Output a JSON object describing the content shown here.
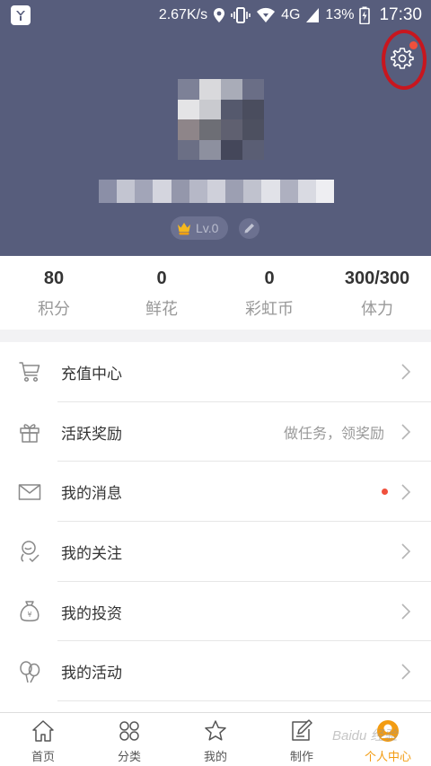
{
  "status_bar": {
    "net_speed": "2.67K/s",
    "network": "4G",
    "battery": "13%",
    "time": "17:30"
  },
  "profile": {
    "level": "Lv.0"
  },
  "stats": [
    {
      "value": "80",
      "label": "积分"
    },
    {
      "value": "0",
      "label": "鲜花"
    },
    {
      "value": "0",
      "label": "彩虹币"
    },
    {
      "value": "300/300",
      "label": "体力"
    }
  ],
  "menu": [
    {
      "label": "充值中心",
      "icon": "cart-icon"
    },
    {
      "label": "活跃奖励",
      "icon": "gift-icon",
      "hint": "做任务，领奖励"
    },
    {
      "label": "我的消息",
      "icon": "envelope-icon",
      "has_dot": true
    },
    {
      "label": "我的关注",
      "icon": "follow-icon"
    },
    {
      "label": "我的投资",
      "icon": "money-bag-icon"
    },
    {
      "label": "我的活动",
      "icon": "balloon-icon"
    }
  ],
  "tabs": [
    {
      "label": "首页",
      "icon": "home-icon"
    },
    {
      "label": "分类",
      "icon": "category-icon"
    },
    {
      "label": "我的",
      "icon": "star-icon"
    },
    {
      "label": "制作",
      "icon": "edit-icon"
    },
    {
      "label": "个人中心",
      "icon": "profile-icon",
      "active": true
    }
  ],
  "watermark": "Baidu 经验",
  "colors": {
    "header_bg": "#575d7c",
    "accent": "#f39c12",
    "notification_dot": "#f0503c",
    "highlight_ring": "#c8161e"
  }
}
